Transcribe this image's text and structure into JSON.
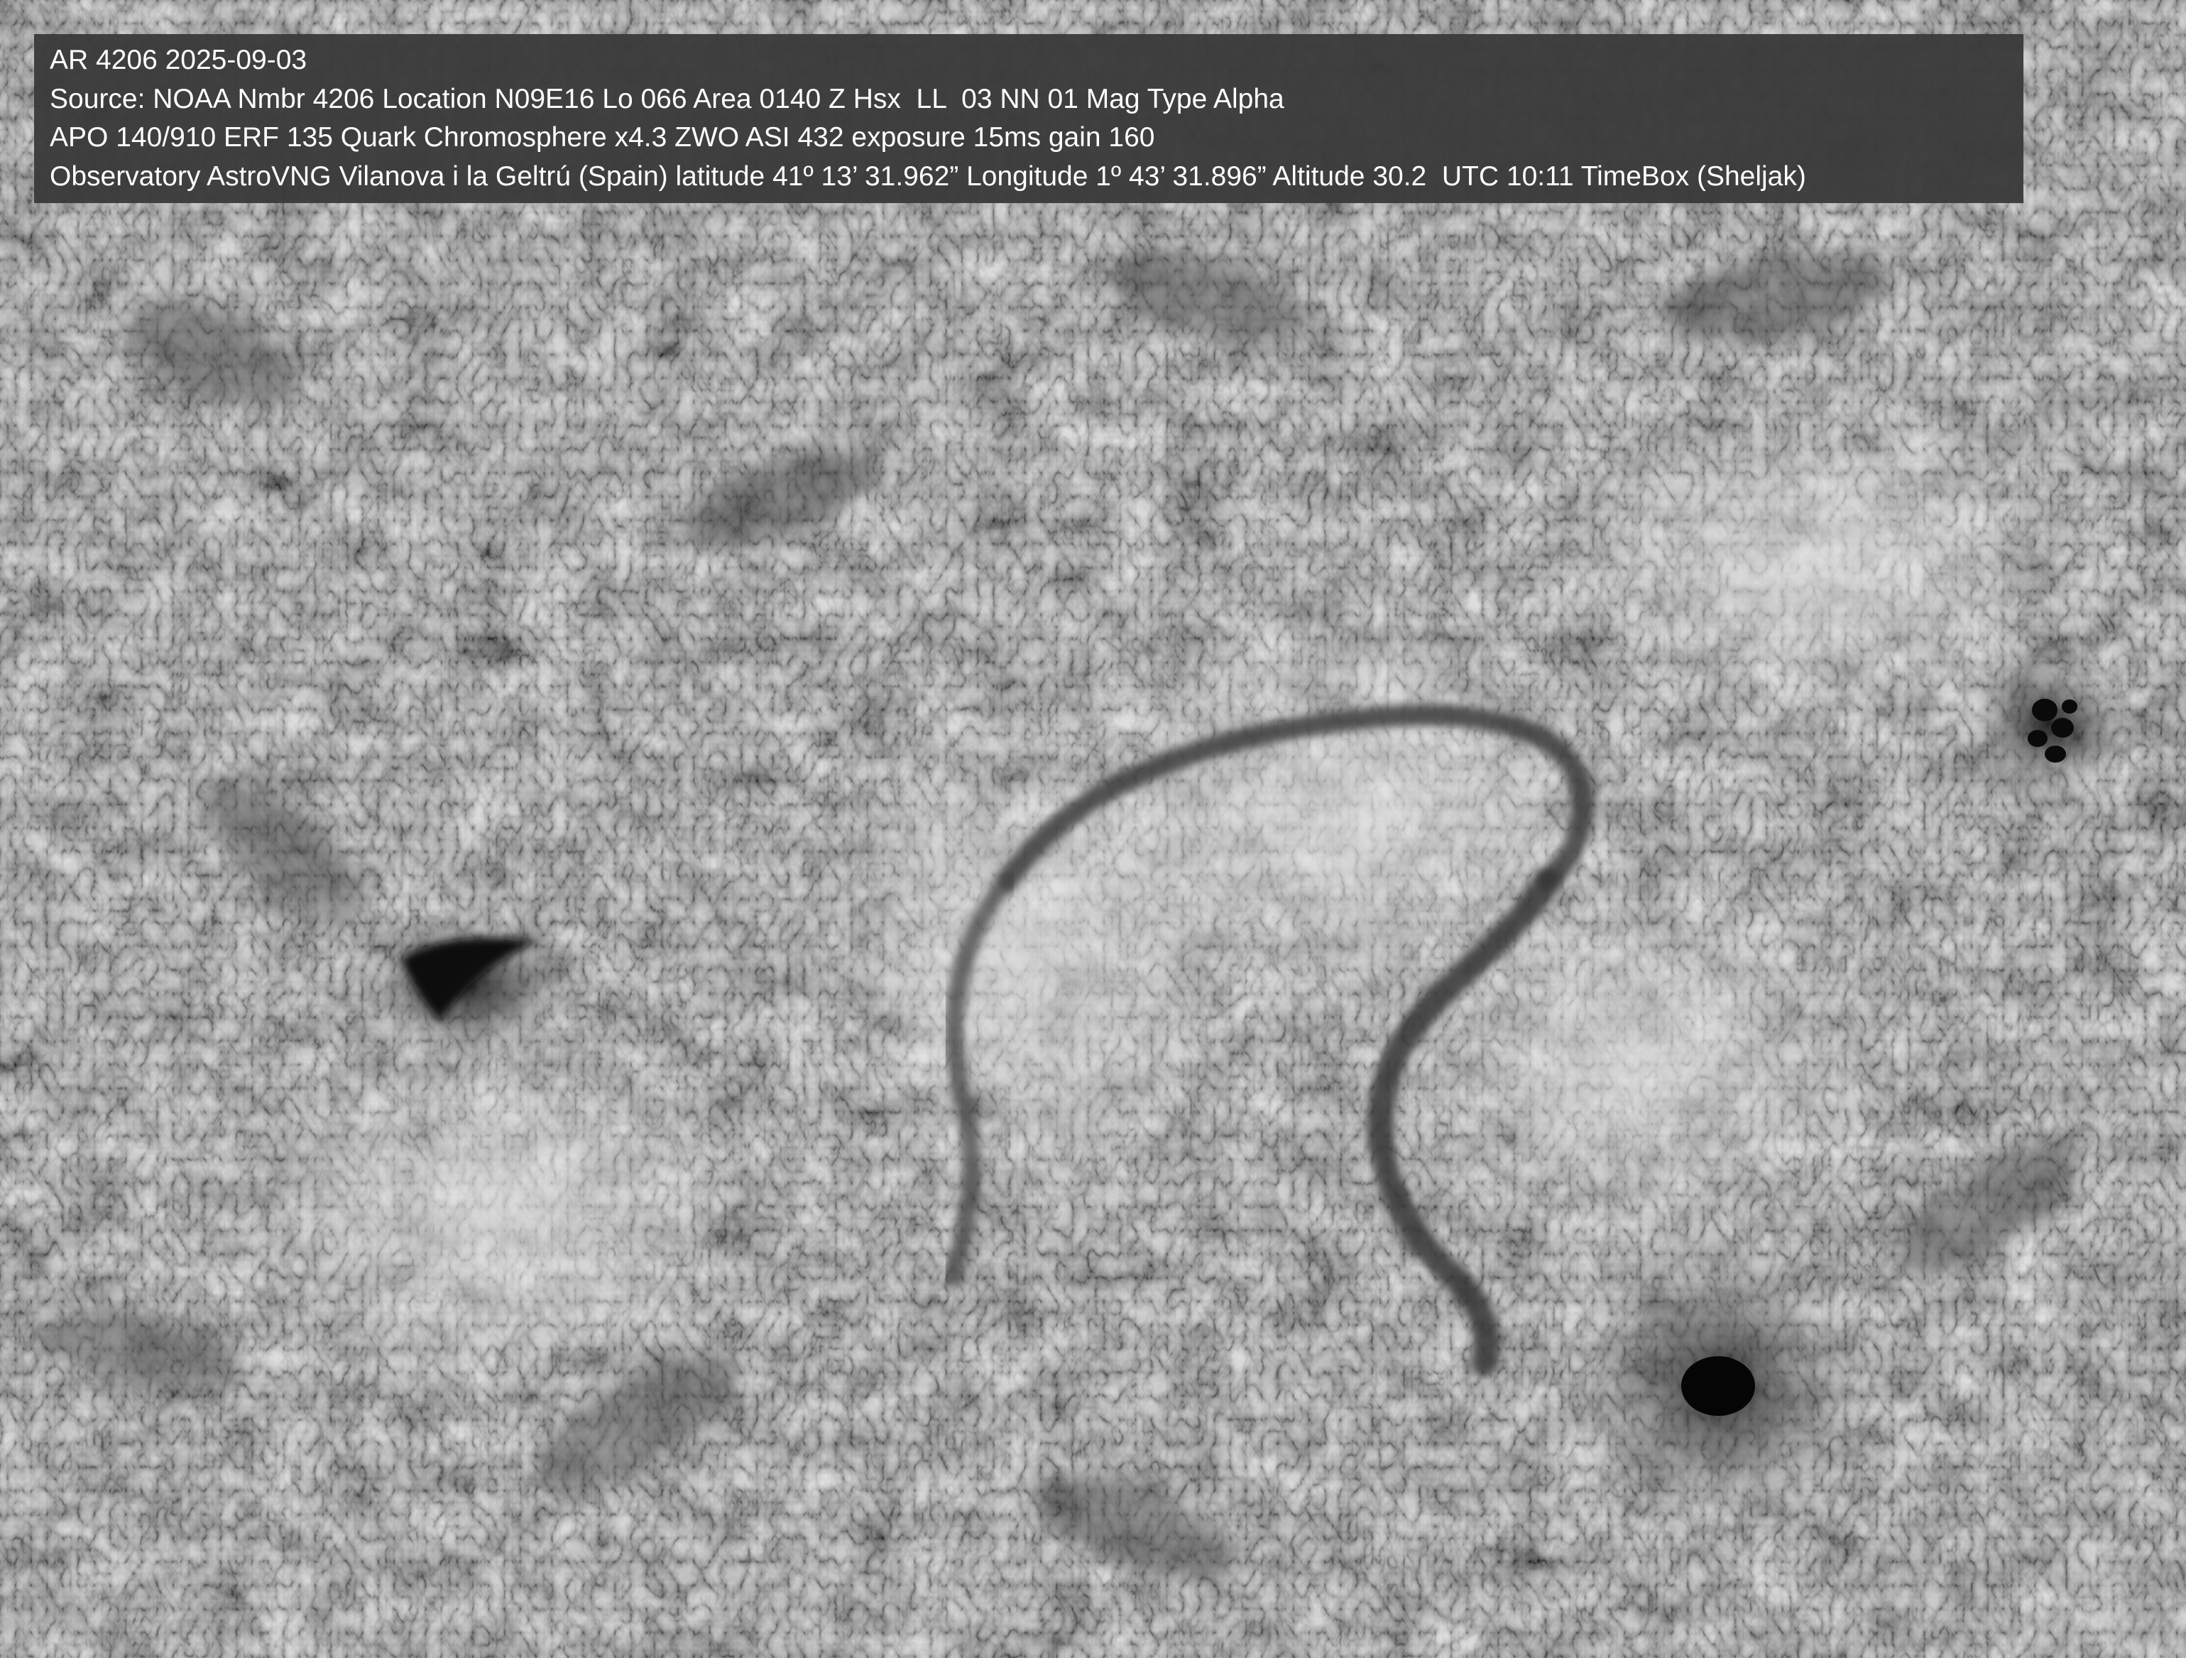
{
  "image": {
    "subject": "solar-chromosphere-h-alpha",
    "palette": {
      "background": "#8e8e8e",
      "bright_plage": "#d8d8d8",
      "dark_fibril": "#3a3a3a",
      "sunspot_core": "#050505",
      "caption_bg": "#3a3a3a",
      "caption_text": "#ffffff"
    }
  },
  "caption": {
    "lines": [
      "AR 4206 2025-09-03",
      "Source: NOAA Nmbr 4206 Location N09E16 Lo 066 Area 0140 Z Hsx  LL  03 NN 01 Mag Type Alpha",
      "APO 140/910 ERF 135 Quark Chromosphere x4.3 ZWO ASI 432 exposure 15ms gain 160",
      "Observatory AstroVNG Vilanova i la Geltrú (Spain) latitude 41º 13’ 31.962” Longitude 1º 43’ 31.896” Altitude 30.2  UTC 10:11 TimeBox (Sheljak)"
    ]
  }
}
